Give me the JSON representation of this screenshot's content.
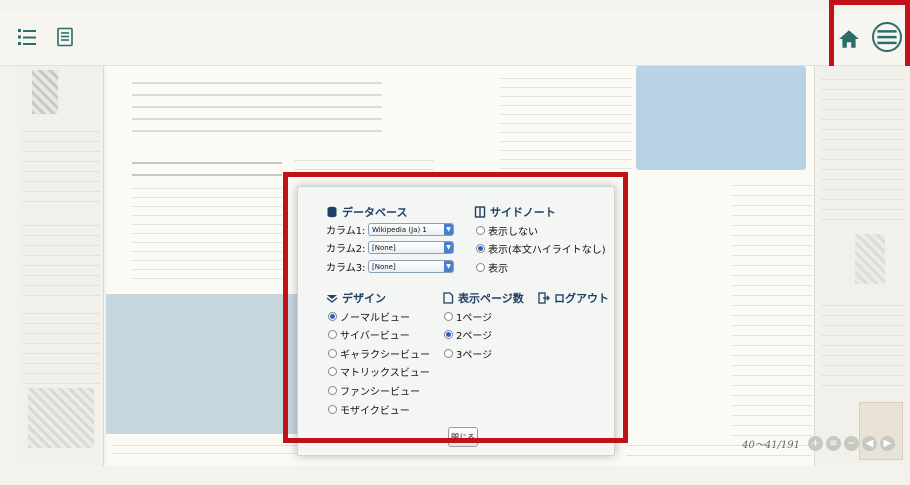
{
  "toolbar": {
    "icons": [
      "list-icon",
      "notes-icon",
      "home-icon",
      "menu-icon"
    ],
    "accent_color": "#2c6e6a",
    "highlight_color": "#c1121a"
  },
  "footer": {
    "page_indicator": "40～41/191"
  },
  "dialog": {
    "database": {
      "title": "データベース",
      "rows": [
        {
          "label": "カラム1:",
          "value": "Wikipedia (Ja) 1"
        },
        {
          "label": "カラム2:",
          "value": "[None]"
        },
        {
          "label": "カラム3:",
          "value": "[None]"
        }
      ]
    },
    "sidenote": {
      "title": "サイドノート",
      "options": [
        {
          "label": "表示しない",
          "selected": false
        },
        {
          "label": "表示(本文ハイライトなし)",
          "selected": true
        },
        {
          "label": "表示",
          "selected": false
        }
      ]
    },
    "design": {
      "title": "デザイン",
      "options": [
        {
          "label": "ノーマルビュー",
          "selected": true
        },
        {
          "label": "サイバービュー",
          "selected": false
        },
        {
          "label": "ギャラクシービュー",
          "selected": false
        },
        {
          "label": "マトリックスビュー",
          "selected": false
        },
        {
          "label": "ファンシービュー",
          "selected": false
        },
        {
          "label": "モザイクビュー",
          "selected": false
        }
      ]
    },
    "pages": {
      "title": "表示ページ数",
      "options": [
        {
          "label": "1ページ",
          "selected": false
        },
        {
          "label": "2ページ",
          "selected": true
        },
        {
          "label": "3ページ",
          "selected": false
        }
      ]
    },
    "logout": {
      "title": "ログアウト"
    },
    "close_label": "閉じる"
  }
}
